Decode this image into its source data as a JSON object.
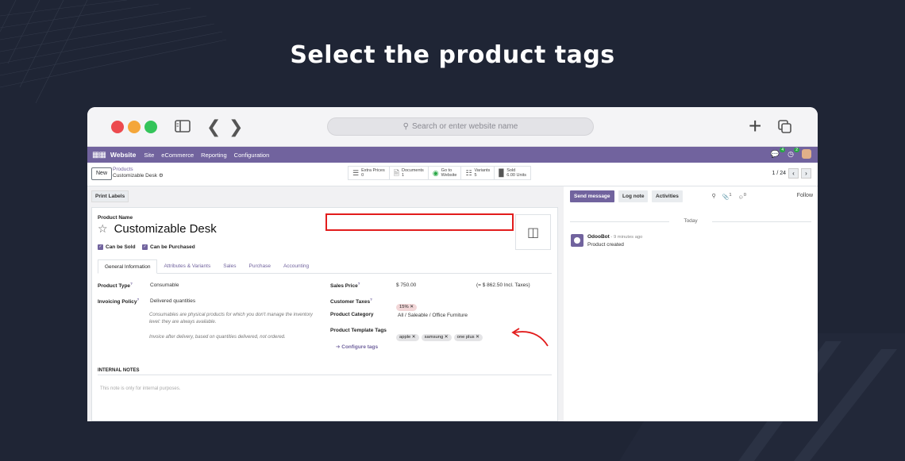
{
  "headline": "Select the product tags",
  "browser": {
    "address_placeholder": "Search or enter website name"
  },
  "topnav": {
    "brand": "Website",
    "menus": [
      "Site",
      "eCommerce",
      "Reporting",
      "Configuration"
    ],
    "messages_count": "4",
    "activities_count": "2"
  },
  "control_panel": {
    "new_label": "New",
    "breadcrumb_parent": "Products",
    "breadcrumb_current": "Customizable Desk",
    "smart_buttons": [
      {
        "label": "Extra Prices",
        "value": "0"
      },
      {
        "label": "Documents",
        "value": "1"
      },
      {
        "label": "Go to",
        "value": "Website"
      },
      {
        "label": "Variants",
        "value": "5"
      },
      {
        "label": "Sold",
        "value": "6.00 Units"
      }
    ],
    "pager": "1 / 24"
  },
  "form": {
    "print_labels": "Print Labels",
    "product_name_label": "Product Name",
    "product_name": "Customizable Desk",
    "can_be_sold": "Can be Sold",
    "can_be_purchased": "Can be Purchased",
    "tabs": [
      "General Information",
      "Attributes & Variants",
      "Sales",
      "Purchase",
      "Accounting"
    ],
    "product_type_label": "Product Type",
    "product_type": "Consumable",
    "invoicing_policy_label": "Invoicing Policy",
    "invoicing_policy": "Delivered quantities",
    "help_consumable": "Consumables are physical products for which you don't manage the inventory level: they are always available.",
    "help_invoice": "Invoice after delivery, based on quantities delivered, not ordered.",
    "sales_price_label": "Sales Price",
    "sales_price": "$ 750.00",
    "sales_price_incl": "(= $ 862.50 Incl. Taxes)",
    "customer_taxes_label": "Customer Taxes",
    "customer_tax_tag": "15% ✕",
    "product_category_label": "Product Category",
    "product_category": "All / Saleable / Office Furniture",
    "template_tags_label": "Product Template Tags",
    "template_tags": [
      "apple ✕",
      "samsung ✕",
      "one plus ✕"
    ],
    "configure_tags": "➔ Configure tags",
    "internal_notes_title": "INTERNAL NOTES",
    "internal_notes_placeholder": "This note is only for internal purposes."
  },
  "chatter": {
    "send_message": "Send message",
    "log_note": "Log note",
    "activities": "Activities",
    "attachments_count": "1",
    "followers_count": "0",
    "follow": "Follow",
    "today": "Today",
    "author": "OdooBot",
    "time": " - 9 minutes ago",
    "body": "Product created"
  }
}
